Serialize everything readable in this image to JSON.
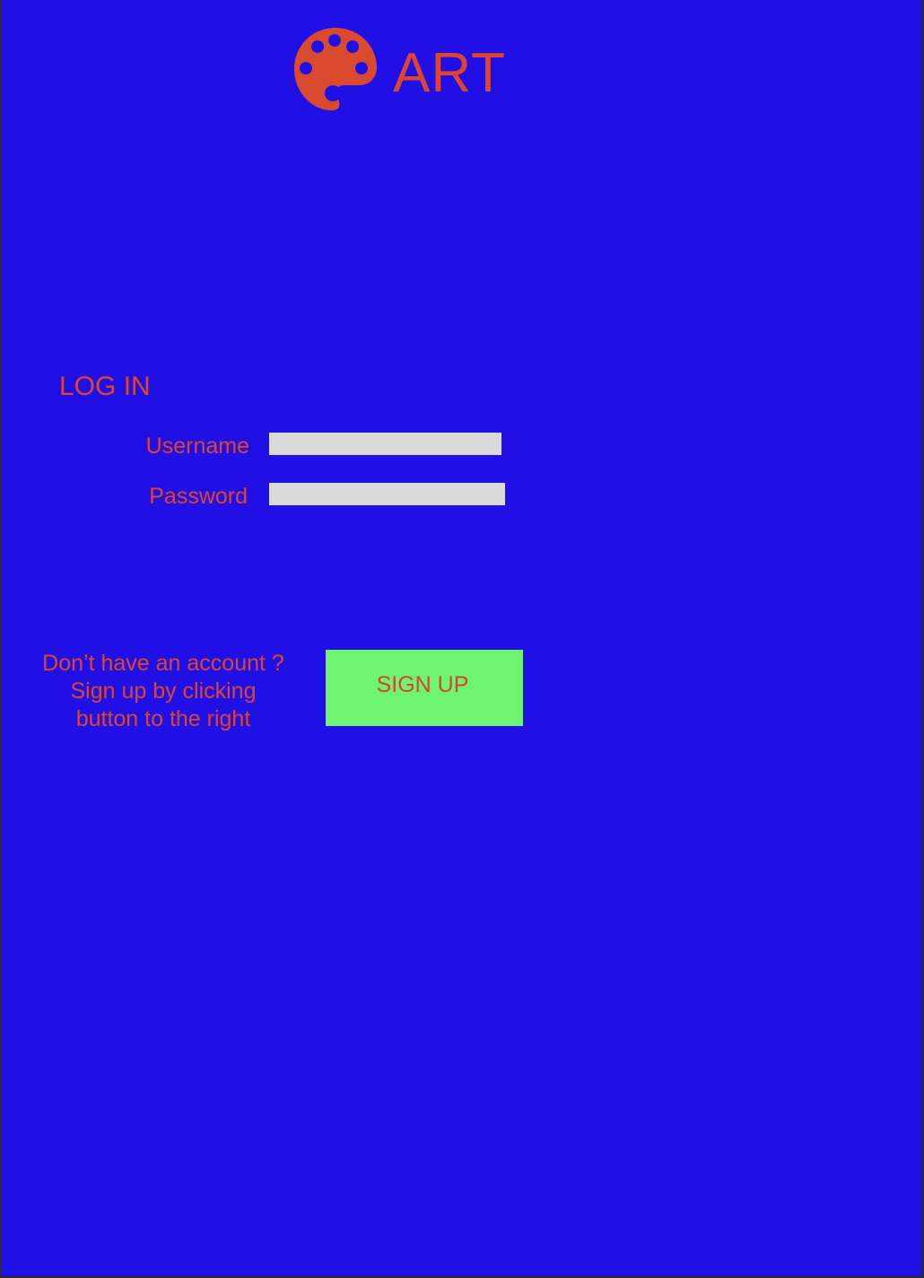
{
  "header": {
    "logo_icon": "palette-icon",
    "brand": "ART"
  },
  "login": {
    "heading": "LOG IN",
    "username_label": "Username",
    "username_value": "",
    "password_label": "Password",
    "password_value": ""
  },
  "signup": {
    "prompt_lines": [
      "Don’t have an account ?",
      "Sign up by clicking",
      "button to the right"
    ],
    "button_label": "SIGN UP"
  },
  "colors": {
    "background": "#2010e6",
    "accent_text": "#e0452c",
    "input_fill": "#d9d9d9",
    "button_fill": "#6ef471"
  }
}
